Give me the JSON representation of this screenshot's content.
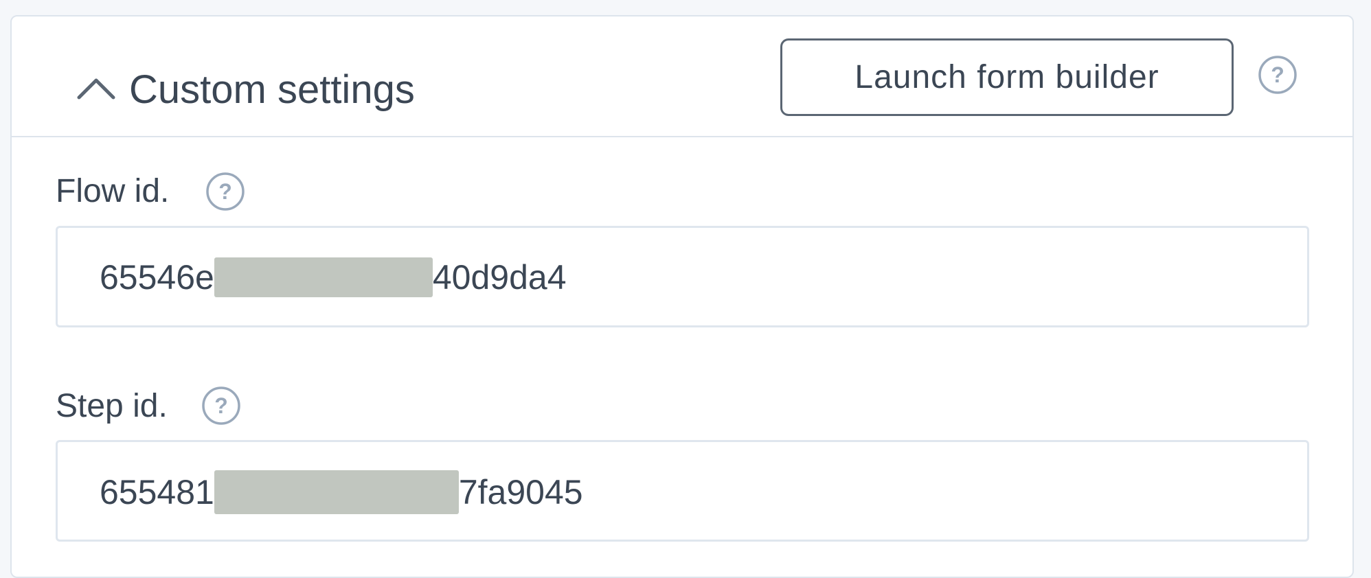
{
  "panel": {
    "title": "Custom settings",
    "launch_button_label": "Launch form builder",
    "expanded": true
  },
  "fields": [
    {
      "label": "Flow id.",
      "value_start": "65546e",
      "value_end": "40d9da4",
      "redacted": true
    },
    {
      "label": "Step id.",
      "value_start": "655481",
      "value_end": "7fa9045",
      "redacted": true
    }
  ],
  "colors": {
    "text": "#3b4654",
    "border": "#dde4ec",
    "help_icon": "#9aa9bb",
    "redaction": "#c1c6bf",
    "page_background": "#f5f7fa"
  },
  "icons": {
    "collapse": "chevron-up-icon",
    "help": "question-circle-icon"
  }
}
